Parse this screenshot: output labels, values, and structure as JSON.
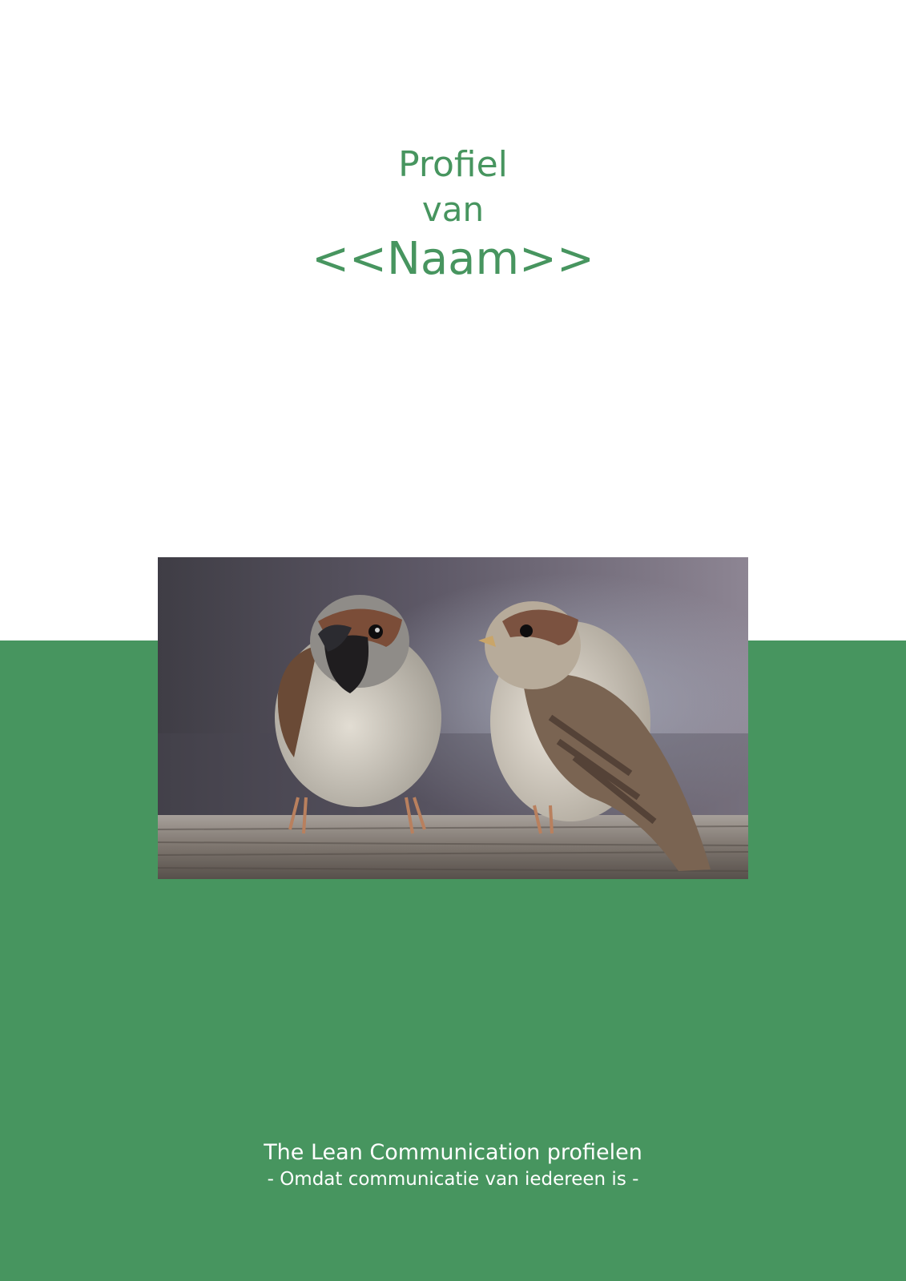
{
  "cover": {
    "title_line1": "Profiel",
    "title_line2": "van",
    "title_line3": "<<Naam>>"
  },
  "photo": {
    "subject": "two sparrows on a wooden rail"
  },
  "footer": {
    "line1": "The Lean Communication profielen",
    "line2": "- Omdat communicatie van iedereen is -"
  },
  "colors": {
    "accent": "#47955f",
    "background": "#ffffff",
    "footer_text": "#ffffff"
  }
}
